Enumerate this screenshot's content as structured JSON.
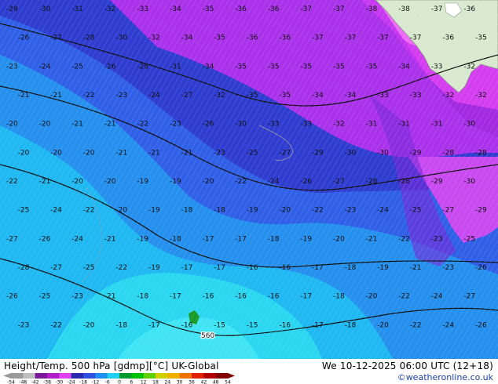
{
  "product": {
    "title": "Height/Temp. 500 hPa [gdmp][°C] UK-Global",
    "valid": "We 10-12-2025 06:00 UTC (12+18)",
    "credit": "©weatheronline.co.uk"
  },
  "colorbar": {
    "ticks": [
      "-54",
      "-48",
      "-42",
      "-38",
      "-30",
      "-24",
      "-18",
      "-12",
      "-6",
      "0",
      "6",
      "12",
      "18",
      "24",
      "30",
      "36",
      "42",
      "48",
      "54"
    ],
    "colors": [
      "#9a9a9a",
      "#bfbfbf",
      "#7a1a9a",
      "#b01ec8",
      "#e040f0",
      "#2a2ab0",
      "#3050e0",
      "#2090f0",
      "#20d0f0",
      "#009a30",
      "#00c000",
      "#60d000",
      "#d0d000",
      "#f0b000",
      "#f07000",
      "#e02000",
      "#b00000",
      "#800000"
    ]
  },
  "map": {
    "contour_label": "560",
    "temperature_grid": [
      [
        "-29",
        "-30",
        "-31",
        "-32",
        "-33",
        "-34",
        "-35",
        "-36",
        "-36",
        "-37",
        "-37",
        "-38",
        "-38",
        "-37",
        "-36"
      ],
      [
        "-26",
        "-27",
        "-28",
        "-30",
        "-32",
        "-34",
        "-35",
        "-36",
        "-36",
        "-37",
        "-37",
        "-37",
        "-37",
        "-36",
        "-35"
      ],
      [
        "-23",
        "-24",
        "-25",
        "-26",
        "-28",
        "-31",
        "-34",
        "-35",
        "-35",
        "-35",
        "-35",
        "-35",
        "-34",
        "-33",
        "-32"
      ],
      [
        "-21",
        "-21",
        "-22",
        "-23",
        "-24",
        "-27",
        "-32",
        "-35",
        "-35",
        "-34",
        "-34",
        "-33",
        "-33",
        "-32",
        "-32"
      ],
      [
        "-20",
        "-20",
        "-21",
        "-21",
        "-22",
        "-23",
        "-26",
        "-30",
        "-33",
        "-33",
        "-32",
        "-31",
        "-31",
        "-31",
        "-30"
      ],
      [
        "-20",
        "-20",
        "-20",
        "-21",
        "-21",
        "-21",
        "-23",
        "-25",
        "-27",
        "-29",
        "-30",
        "-30",
        "-29",
        "-28",
        "-28"
      ],
      [
        "-22",
        "-21",
        "-20",
        "-20",
        "-19",
        "-19",
        "-20",
        "-22",
        "-24",
        "-26",
        "-27",
        "-28",
        "-28",
        "-29",
        "-30"
      ],
      [
        "-25",
        "-24",
        "-22",
        "-20",
        "-19",
        "-18",
        "-18",
        "-19",
        "-20",
        "-22",
        "-23",
        "-24",
        "-25",
        "-27",
        "-29"
      ],
      [
        "-27",
        "-26",
        "-24",
        "-21",
        "-19",
        "-18",
        "-17",
        "-17",
        "-18",
        "-19",
        "-20",
        "-21",
        "-22",
        "-23",
        "-25"
      ],
      [
        "-28",
        "-27",
        "-25",
        "-22",
        "-19",
        "-17",
        "-17",
        "-16",
        "-16",
        "-17",
        "-18",
        "-19",
        "-21",
        "-23",
        "-26"
      ],
      [
        "-26",
        "-25",
        "-23",
        "-21",
        "-18",
        "-17",
        "-16",
        "-16",
        "-16",
        "-17",
        "-18",
        "-20",
        "-22",
        "-24",
        "-27"
      ],
      [
        "-23",
        "-22",
        "-20",
        "-18",
        "-17",
        "-16",
        "-15",
        "-15",
        "-16",
        "-17",
        "-18",
        "-20",
        "-22",
        "-24",
        "-26"
      ]
    ]
  }
}
